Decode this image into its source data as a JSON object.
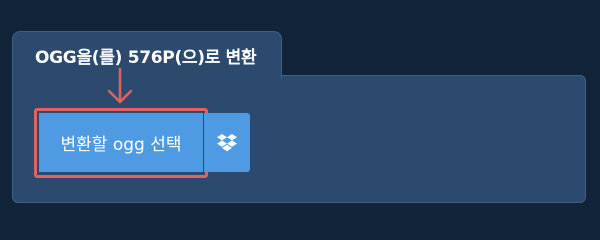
{
  "tab": {
    "title": "OGG을(를) 576P(으)로 변환"
  },
  "uploader": {
    "select_button_label": "변환할 ogg 선택"
  },
  "icons": {
    "arrow": "arrow-down-icon",
    "dropbox": "dropbox-icon"
  },
  "colors": {
    "page_background": "#12243a",
    "panel_background": "#2c4a6d",
    "button_blue": "#4e9be3",
    "highlight_red": "#e06262"
  }
}
